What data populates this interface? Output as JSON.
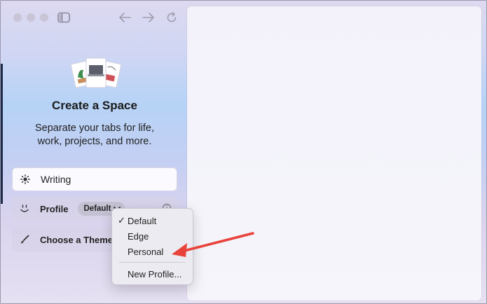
{
  "window": {
    "toolbar_icons": [
      "sidebar-icon",
      "back-arrow-icon",
      "forward-arrow-icon",
      "reload-icon"
    ]
  },
  "sidebar": {
    "title": "Create a Space",
    "subtitle": "Separate your tabs for life, work, projects, and more.",
    "name_field": {
      "value": "Writing",
      "icon": "sun-icon"
    },
    "profile_row": {
      "label": "Profile",
      "selected": "Default",
      "icon": "smiley-icon"
    },
    "theme_row": {
      "label": "Choose a Theme",
      "icon": "brush-icon"
    }
  },
  "profile_menu": {
    "items": [
      {
        "label": "Default",
        "checked": true
      },
      {
        "label": "Edge"
      },
      {
        "label": "Personal"
      },
      {
        "label": "New Profile..."
      }
    ]
  },
  "colors": {
    "annotation_arrow": "#e8433a",
    "sidebar_top": "#ddd9f0",
    "sidebar_mid": "#b6d3f6"
  }
}
